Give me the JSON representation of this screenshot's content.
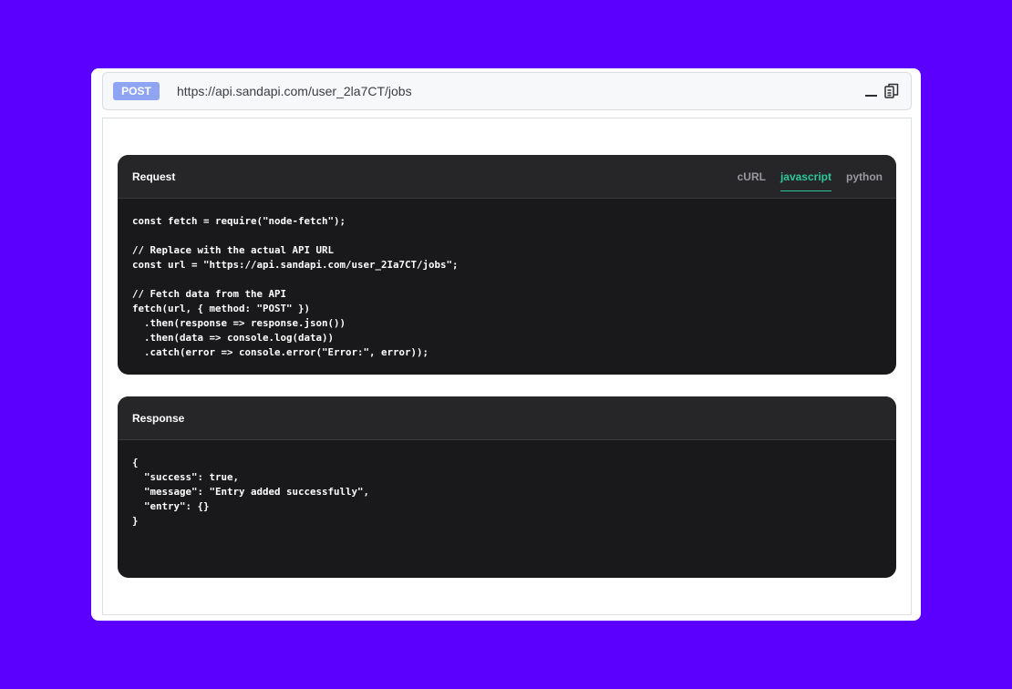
{
  "endpoint": {
    "method": "POST",
    "url": "https://api.sandapi.com/user_2la7CT/jobs"
  },
  "icons": {
    "minimize": "minimize-icon",
    "copy": "copy-icon"
  },
  "request": {
    "title": "Request",
    "tabs": [
      {
        "label": "cURL",
        "active": false
      },
      {
        "label": "javascript",
        "active": true
      },
      {
        "label": "python",
        "active": false
      }
    ],
    "code": "const fetch = require(\"node-fetch\");\n\n// Replace with the actual API URL\nconst url = \"https://api.sandapi.com/user_2Ia7CT/jobs\";\n\n// Fetch data from the API\nfetch(url, { method: \"POST\" })\n  .then(response => response.json())\n  .then(data => console.log(data))\n  .catch(error => console.error(\"Error:\", error));"
  },
  "response": {
    "title": "Response",
    "code": "{\n  \"success\": true,\n  \"message\": \"Entry added successfully\",\n  \"entry\": {}\n}"
  },
  "colors": {
    "background": "#5b00ff",
    "method_badge": "#8fa4f3",
    "active_tab": "#2ec79a",
    "panel": "#19191b",
    "panel_header": "#262628"
  }
}
